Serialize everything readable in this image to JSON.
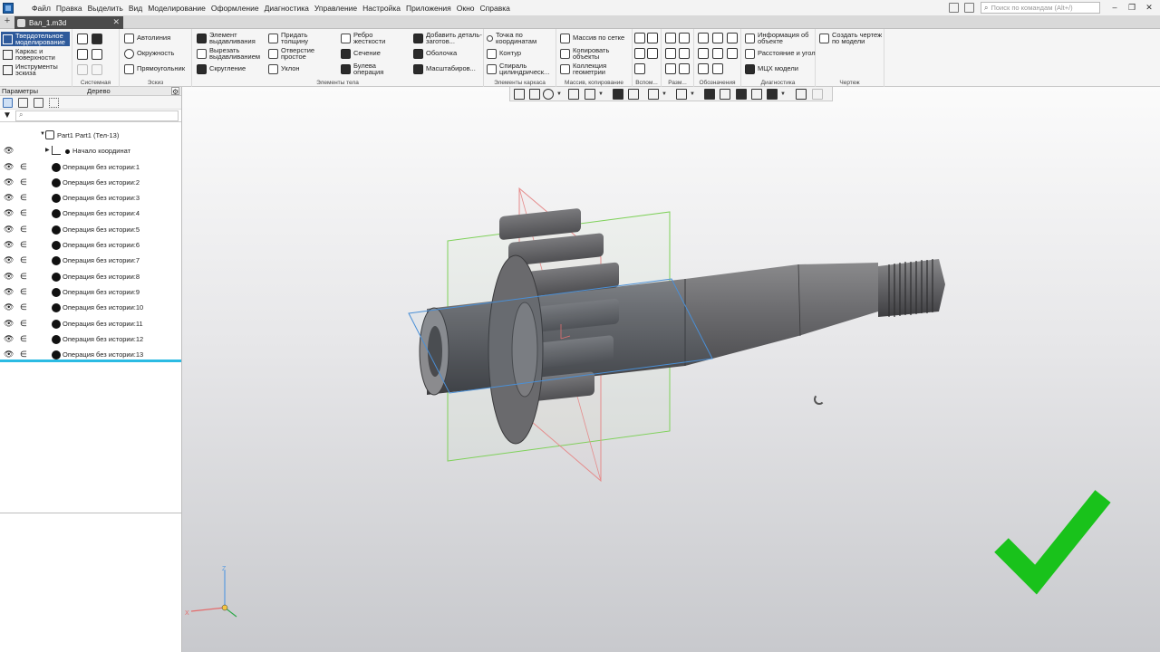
{
  "menubar": {
    "items": [
      "Файл",
      "Правка",
      "Выделить",
      "Вид",
      "Моделирование",
      "Оформление",
      "Диагностика",
      "Управление",
      "Настройка",
      "Приложения",
      "Окно",
      "Справка"
    ],
    "search_placeholder": "Поиск по командам (Alt+/)"
  },
  "tabbar": {
    "document_tab": "Вал_1.m3d"
  },
  "ribbon": {
    "modes": {
      "solid": "Твердотельное моделирование",
      "surfaces": "Каркас и поверхности",
      "sketch_tools": "Инструменты эскиза"
    },
    "groups": {
      "system": "Системная",
      "sketch": "Эскиз",
      "body_elements": "Элементы тела",
      "wireframe": "Элементы каркаса",
      "arrays": "Массив, копирование",
      "auxiliary": "Вспом...",
      "dimensions": "Разм...",
      "annotations": "Обозначения",
      "diagnostics": "Диагностика",
      "drawing": "Чертеж"
    },
    "buttons": {
      "autoline": "Автолиния",
      "circle": "Окружность",
      "rectangle": "Прямоугольник",
      "extrude": "Элемент выдавливания",
      "cut_extrude": "Вырезать выдавливанием",
      "fillet": "Скругление",
      "thicken": "Придать толщину",
      "hole": "Отверстие простое",
      "draft": "Уклон",
      "rib": "Ребро жесткости",
      "section": "Сечение",
      "boolean": "Булева операция",
      "add_part": "Добавить деталь-заготов...",
      "shell": "Оболочка",
      "scale": "Масштабиров...",
      "point_coords": "Точка по координатам",
      "contour": "Контур",
      "spiral": "Спираль цилиндрическ...",
      "grid_array": "Массив по сетке",
      "copy_objects": "Копировать объекты",
      "geometry_collection": "Коллекция геометрии",
      "object_info": "Информация об объекте",
      "distance_angle": "Расстояние и угол",
      "mass_properties": "МЦХ модели",
      "create_drawing": "Создать чертеж по модели"
    }
  },
  "panel": {
    "tabs": [
      "Параметры",
      "Дерево"
    ],
    "tree": {
      "root": "Part1 Part1 (Тел-13)",
      "origin": "Начало координат",
      "operations": [
        "Операция без истории:1",
        "Операция без истории:2",
        "Операция без истории:3",
        "Операция без истории:4",
        "Операция без истории:5",
        "Операция без истории:6",
        "Операция без истории:7",
        "Операция без истории:8",
        "Операция без истории:9",
        "Операция без истории:10",
        "Операция без истории:11",
        "Операция без истории:12",
        "Операция без истории:13"
      ],
      "selected": "Операция без истории:13"
    }
  },
  "viewport": {
    "axis_labels": {
      "z": "Z",
      "x": "X"
    },
    "colors": {
      "model": "#6f6f71",
      "plane_green": "#7fd15a",
      "plane_red": "#e58b8b",
      "plane_blue": "#4a8fd6",
      "checkmark": "#19c21b"
    }
  },
  "icons": {
    "visibility": "eye-icon",
    "membership": "element-of-icon",
    "filter": "filter-icon",
    "search": "search-icon",
    "status": "checkmark-icon"
  }
}
